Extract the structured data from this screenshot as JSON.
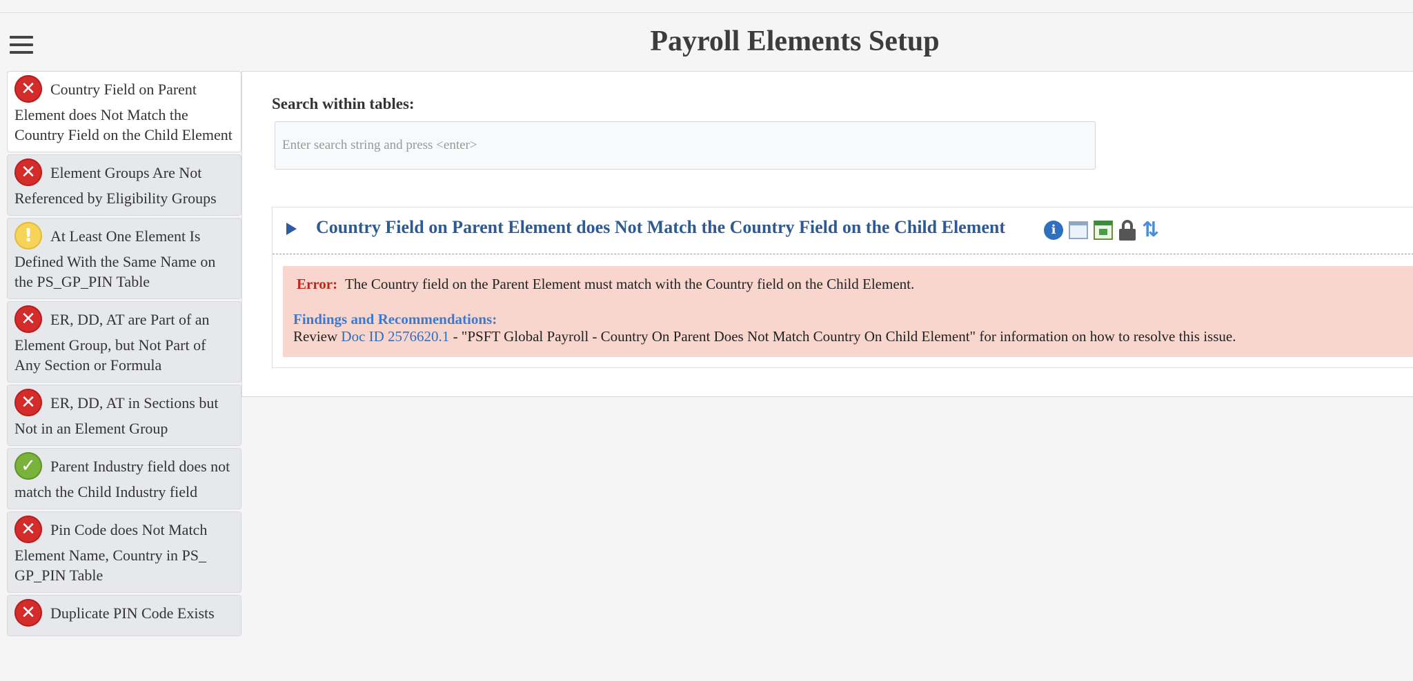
{
  "header": {
    "title": "Payroll Elements Setup"
  },
  "sidebar": {
    "items": [
      {
        "status": "error",
        "label": "Country Field on Parent Element does Not Match the Country Field on the Child Element",
        "active": true
      },
      {
        "status": "error",
        "label": "Element Groups Are Not Referenced by Eligibility Groups"
      },
      {
        "status": "warning",
        "label": "At Least One Element Is Defined With the Same Name on the PS_GP_PIN Table"
      },
      {
        "status": "error",
        "label": "ER, DD, AT are Part of an Element Group, but Not Part of Any Section or Formula"
      },
      {
        "status": "error",
        "label": "ER, DD, AT in Sections but Not in an Element Group"
      },
      {
        "status": "ok",
        "label": "Parent Industry field does not match the Child Industry field"
      },
      {
        "status": "error",
        "label": "Pin Code does Not Match Element Name, Country in PS_ GP_PIN Table"
      },
      {
        "status": "error",
        "label": "Duplicate PIN Code Exists"
      }
    ],
    "icons": {
      "error": "✕",
      "warning": "!",
      "ok": "✓"
    }
  },
  "main": {
    "search": {
      "label": "Search within tables:",
      "value": "",
      "placeholder": "Enter search string and press <enter>"
    },
    "section": {
      "title": "Country Field on Parent Element does Not Match the Country Field on the Child Element",
      "header_icons": [
        "info-icon",
        "window-icon",
        "excel-icon",
        "lock-icon",
        "sort-icon"
      ],
      "info_glyph": "i",
      "sort_glyph": "⇅",
      "error_label": "Error:",
      "error_text": "The Country field on the Parent Element must match with the Country field on the Child Element.",
      "findings_title": "Findings and Recommendations:",
      "review_prefix": "Review ",
      "doc_link": "Doc ID 2576620.1",
      "review_suffix": " - \"PSFT Global Payroll - Country On Parent Does Not Match Country On Child Element\" for information on how to resolve this issue."
    }
  },
  "colors": {
    "error": "#d42b2b",
    "warning": "#f6d45a",
    "ok": "#7ab33c",
    "link": "#2f6fbf",
    "title": "#2e5a93",
    "error_bg": "#f8d6ce"
  }
}
